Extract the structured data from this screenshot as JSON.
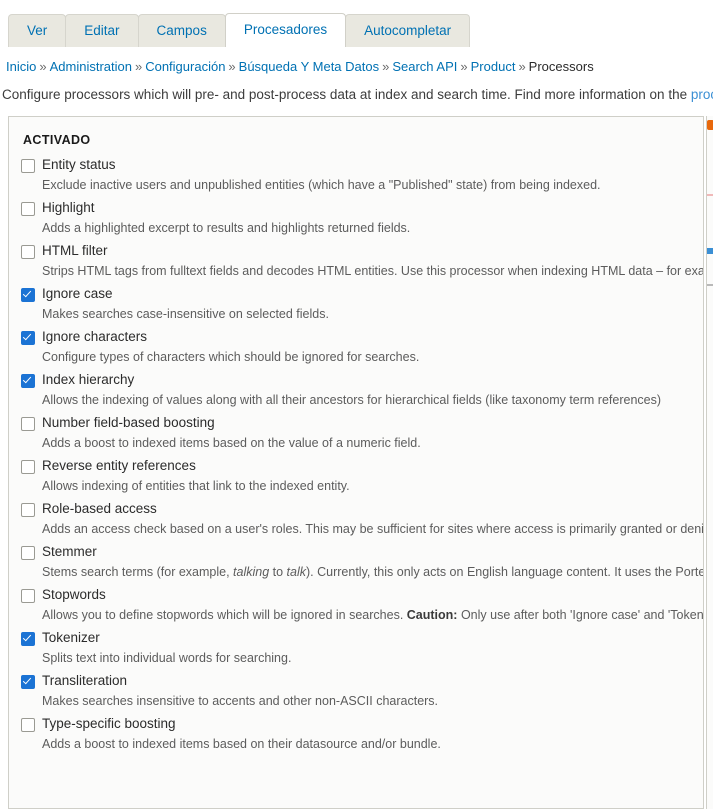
{
  "tabs": [
    {
      "label": "Ver",
      "active": false
    },
    {
      "label": "Editar",
      "active": false
    },
    {
      "label": "Campos",
      "active": false
    },
    {
      "label": "Procesadores",
      "active": true
    },
    {
      "label": "Autocompletar",
      "active": false
    }
  ],
  "breadcrumb": {
    "items": [
      {
        "label": "Inicio",
        "link": true
      },
      {
        "label": "Administration",
        "link": true
      },
      {
        "label": "Configuración",
        "link": true
      },
      {
        "label": "Búsqueda Y Meta Datos",
        "link": true
      },
      {
        "label": "Search API",
        "link": true
      },
      {
        "label": "Product",
        "link": true
      },
      {
        "label": "Processors",
        "link": false
      }
    ],
    "separator": "»"
  },
  "intro": {
    "text": "Configure processors which will pre- and post-process data at index and search time. Find more information on the ",
    "link_text": "proce"
  },
  "panel": {
    "title": "ACTIVADO",
    "processors": [
      {
        "name": "Entity status",
        "checked": false,
        "description": "Exclude inactive users and unpublished entities (which have a \"Published\" state) from being indexed."
      },
      {
        "name": "Highlight",
        "checked": false,
        "description": "Adds a highlighted excerpt to results and highlights returned fields."
      },
      {
        "name": "HTML filter",
        "checked": false,
        "description": "Strips HTML tags from fulltext fields and decodes HTML entities. Use this processor when indexing HTML data – for examp"
      },
      {
        "name": "Ignore case",
        "checked": true,
        "description": "Makes searches case-insensitive on selected fields."
      },
      {
        "name": "Ignore characters",
        "checked": true,
        "description": "Configure types of characters which should be ignored for searches."
      },
      {
        "name": "Index hierarchy",
        "checked": true,
        "description": "Allows the indexing of values along with all their ancestors for hierarchical fields (like taxonomy term references)"
      },
      {
        "name": "Number field-based boosting",
        "checked": false,
        "description": "Adds a boost to indexed items based on the value of a numeric field."
      },
      {
        "name": "Reverse entity references",
        "checked": false,
        "description": "Allows indexing of entities that link to the indexed entity."
      },
      {
        "name": "Role-based access",
        "checked": false,
        "description": "Adds an access check based on a user's roles. This may be sufficient for sites where access is primarily granted or denied"
      },
      {
        "name": "Stemmer",
        "checked": false,
        "description_html": "Stems search terms (for example, <em>talking</em> to <em>talk</em>). Currently, this only acts on English language content. It uses the Porter"
      },
      {
        "name": "Stopwords",
        "checked": false,
        "description_html": "Allows you to define stopwords which will be ignored in searches. <b>Caution:</b> Only use after both 'Ignore case' and 'Tokeniz"
      },
      {
        "name": "Tokenizer",
        "checked": true,
        "description": "Splits text into individual words for searching."
      },
      {
        "name": "Transliteration",
        "checked": true,
        "description": "Makes searches insensitive to accents and other non-ASCII characters."
      },
      {
        "name": "Type-specific boosting",
        "checked": false,
        "description": "Adds a boost to indexed items based on their datasource and/or bundle."
      }
    ]
  },
  "colors": {
    "tab_link": "#0071b3",
    "checkbox_checked": "#1b73d4",
    "panel_bg": "#fbfbfa",
    "panel_border": "#cfcfc8",
    "accent_orange": "#e8680b"
  }
}
